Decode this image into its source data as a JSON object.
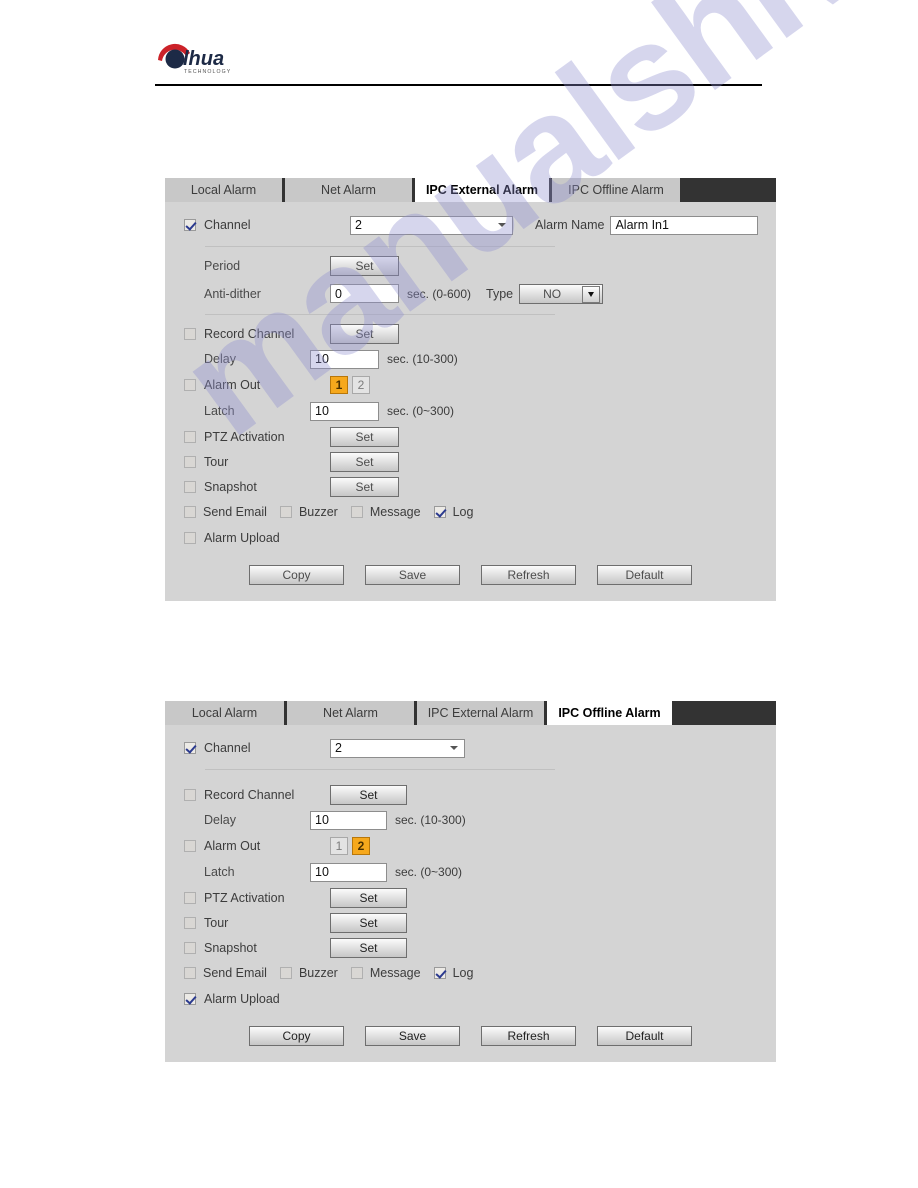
{
  "brand": {
    "name": "alhua",
    "sub": "TECHNOLOGY"
  },
  "watermark": {
    "text": "manualshive.com"
  },
  "tabs": [
    {
      "label": "Local Alarm"
    },
    {
      "label": "Net Alarm"
    },
    {
      "label": "IPC External Alarm"
    },
    {
      "label": "IPC Offline Alarm"
    }
  ],
  "labels": {
    "channel": "Channel",
    "alarm_name": "Alarm Name",
    "period": "Period",
    "anti_dither": "Anti-dither",
    "type": "Type",
    "record_channel": "Record Channel",
    "delay": "Delay",
    "alarm_out": "Alarm Out",
    "latch": "Latch",
    "ptz_activation": "PTZ Activation",
    "tour": "Tour",
    "snapshot": "Snapshot",
    "send_email": "Send Email",
    "buzzer": "Buzzer",
    "message": "Message",
    "log": "Log",
    "alarm_upload": "Alarm Upload",
    "set": "Set"
  },
  "hints": {
    "anti_dither": "sec. (0-600)",
    "delay": "sec. (10-300)",
    "latch": "sec. (0~300)"
  },
  "buttons": {
    "copy": "Copy",
    "save": "Save",
    "refresh": "Refresh",
    "default": "Default"
  },
  "panel1": {
    "active_tab": "IPC External Alarm",
    "channel_checked": true,
    "channel_value": "2",
    "alarm_name_value": "Alarm In1",
    "anti_dither_value": "0",
    "type_value": "NO",
    "record_channel_checked": false,
    "delay_value": "10",
    "alarm_out_checked": false,
    "alarm_out_options": [
      "1",
      "2"
    ],
    "alarm_out_selected": "1",
    "latch_value": "10",
    "ptz_checked": false,
    "tour_checked": false,
    "snapshot_checked": false,
    "send_email_checked": false,
    "buzzer_checked": false,
    "message_checked": false,
    "log_checked": true,
    "alarm_upload_checked": false
  },
  "panel2": {
    "active_tab": "IPC Offline Alarm",
    "channel_checked": true,
    "channel_value": "2",
    "record_channel_checked": false,
    "delay_value": "10",
    "alarm_out_checked": false,
    "alarm_out_options": [
      "1",
      "2"
    ],
    "alarm_out_selected": "2",
    "latch_value": "10",
    "ptz_checked": false,
    "tour_checked": false,
    "snapshot_checked": false,
    "send_email_checked": false,
    "buzzer_checked": false,
    "message_checked": false,
    "log_checked": true,
    "alarm_upload_checked": true
  },
  "colors": {
    "accent_orange": "#f6a81c",
    "tabbar_dark": "#333333",
    "panel_gray": "#d4d4d4",
    "brand_red": "#cc2229",
    "watermark": "#8f8fd0"
  }
}
